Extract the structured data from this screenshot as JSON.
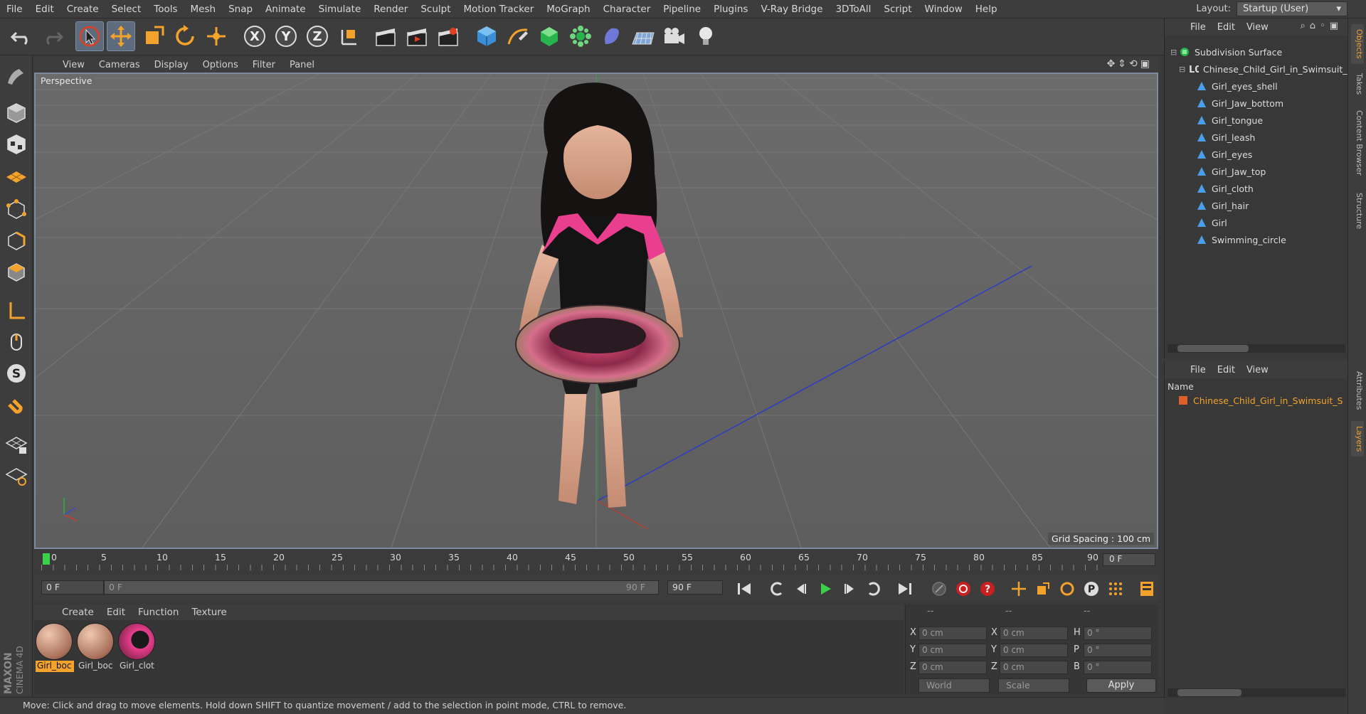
{
  "menubar": {
    "items": [
      "File",
      "Edit",
      "Create",
      "Select",
      "Tools",
      "Mesh",
      "Snap",
      "Animate",
      "Simulate",
      "Render",
      "Sculpt",
      "Motion Tracker",
      "MoGraph",
      "Character",
      "Pipeline",
      "Plugins",
      "V-Ray Bridge",
      "3DToAll",
      "Script",
      "Window",
      "Help"
    ],
    "layout_label": "Layout:",
    "layout_value": "Startup (User)"
  },
  "viewport": {
    "menu": [
      "View",
      "Cameras",
      "Display",
      "Options",
      "Filter",
      "Panel"
    ],
    "label": "Perspective",
    "grid_spacing": "Grid Spacing : 100 cm"
  },
  "timeline": {
    "ticks": [
      "0",
      "5",
      "10",
      "15",
      "20",
      "25",
      "30",
      "35",
      "40",
      "45",
      "50",
      "55",
      "60",
      "65",
      "70",
      "75",
      "80",
      "85",
      "90"
    ],
    "current_frame_right": "0 F",
    "start_field": "0 F",
    "slider_left": "0 F",
    "slider_right": "90 F",
    "end_field": "90 F"
  },
  "material_manager": {
    "menu": [
      "Create",
      "Edit",
      "Function",
      "Texture"
    ],
    "materials": [
      {
        "label": "Girl_boc",
        "selected": true
      },
      {
        "label": "Girl_boc",
        "selected": false
      },
      {
        "label": "Girl_clot",
        "selected": false
      }
    ]
  },
  "coords": {
    "headers": [
      "--",
      "--",
      "--"
    ],
    "rows": [
      {
        "a_lbl": "X",
        "a_val": "0 cm",
        "b_lbl": "X",
        "b_val": "0 cm",
        "c_lbl": "H",
        "c_val": "0 °"
      },
      {
        "a_lbl": "Y",
        "a_val": "0 cm",
        "b_lbl": "Y",
        "b_val": "0 cm",
        "c_lbl": "P",
        "c_val": "0 °"
      },
      {
        "a_lbl": "Z",
        "a_val": "0 cm",
        "b_lbl": "Z",
        "b_val": "0 cm",
        "c_lbl": "B",
        "c_val": "0 °"
      }
    ],
    "mode": "World",
    "scale": "Scale",
    "apply": "Apply"
  },
  "status": "Move: Click and drag to move elements. Hold down SHIFT to quantize movement / add to the selection in point mode, CTRL to remove.",
  "objects_panel": {
    "menu": [
      "File",
      "Edit",
      "View"
    ],
    "root": "Subdivision Surface",
    "group": "Chinese_Child_Girl_in_Swimsuit_",
    "children": [
      "Girl_eyes_shell",
      "Girl_Jaw_bottom",
      "Girl_tongue",
      "Girl_leash",
      "Girl_eyes",
      "Girl_Jaw_top",
      "Girl_cloth",
      "Girl_hair",
      "Girl",
      "Swimming_circle"
    ]
  },
  "layers_panel": {
    "menu": [
      "File",
      "Edit",
      "View"
    ],
    "col_name": "Name",
    "layer": "Chinese_Child_Girl_in_Swimsuit_S"
  },
  "right_tabs": [
    "Objects",
    "Takes",
    "Content Browser",
    "Structure",
    "Attributes",
    "Layers"
  ],
  "brand": [
    "MAXON",
    "CINEMA 4D"
  ],
  "colors": {
    "accent": "#f3a32b",
    "active_tool": "#5d6b7c",
    "bg": "#3d3d3d"
  }
}
